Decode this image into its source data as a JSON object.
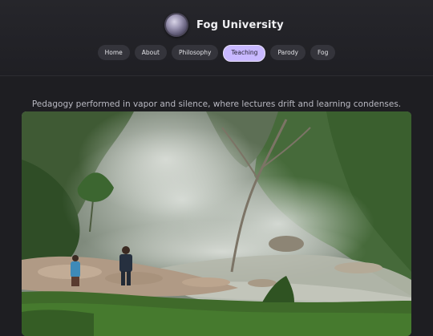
{
  "site": {
    "title": "Fog University"
  },
  "nav": {
    "items": [
      {
        "label": "Home"
      },
      {
        "label": "About"
      },
      {
        "label": "Philosophy"
      },
      {
        "label": "Teaching",
        "active": true
      },
      {
        "label": "Parody"
      },
      {
        "label": "Fog"
      }
    ]
  },
  "main": {
    "tagline": "Pedagogy performed in vapor and silence, where lectures drift and learning condenses."
  },
  "colors": {
    "background": "#1e1e22",
    "accent": "#c8b8ff",
    "pill": "#34343b"
  }
}
